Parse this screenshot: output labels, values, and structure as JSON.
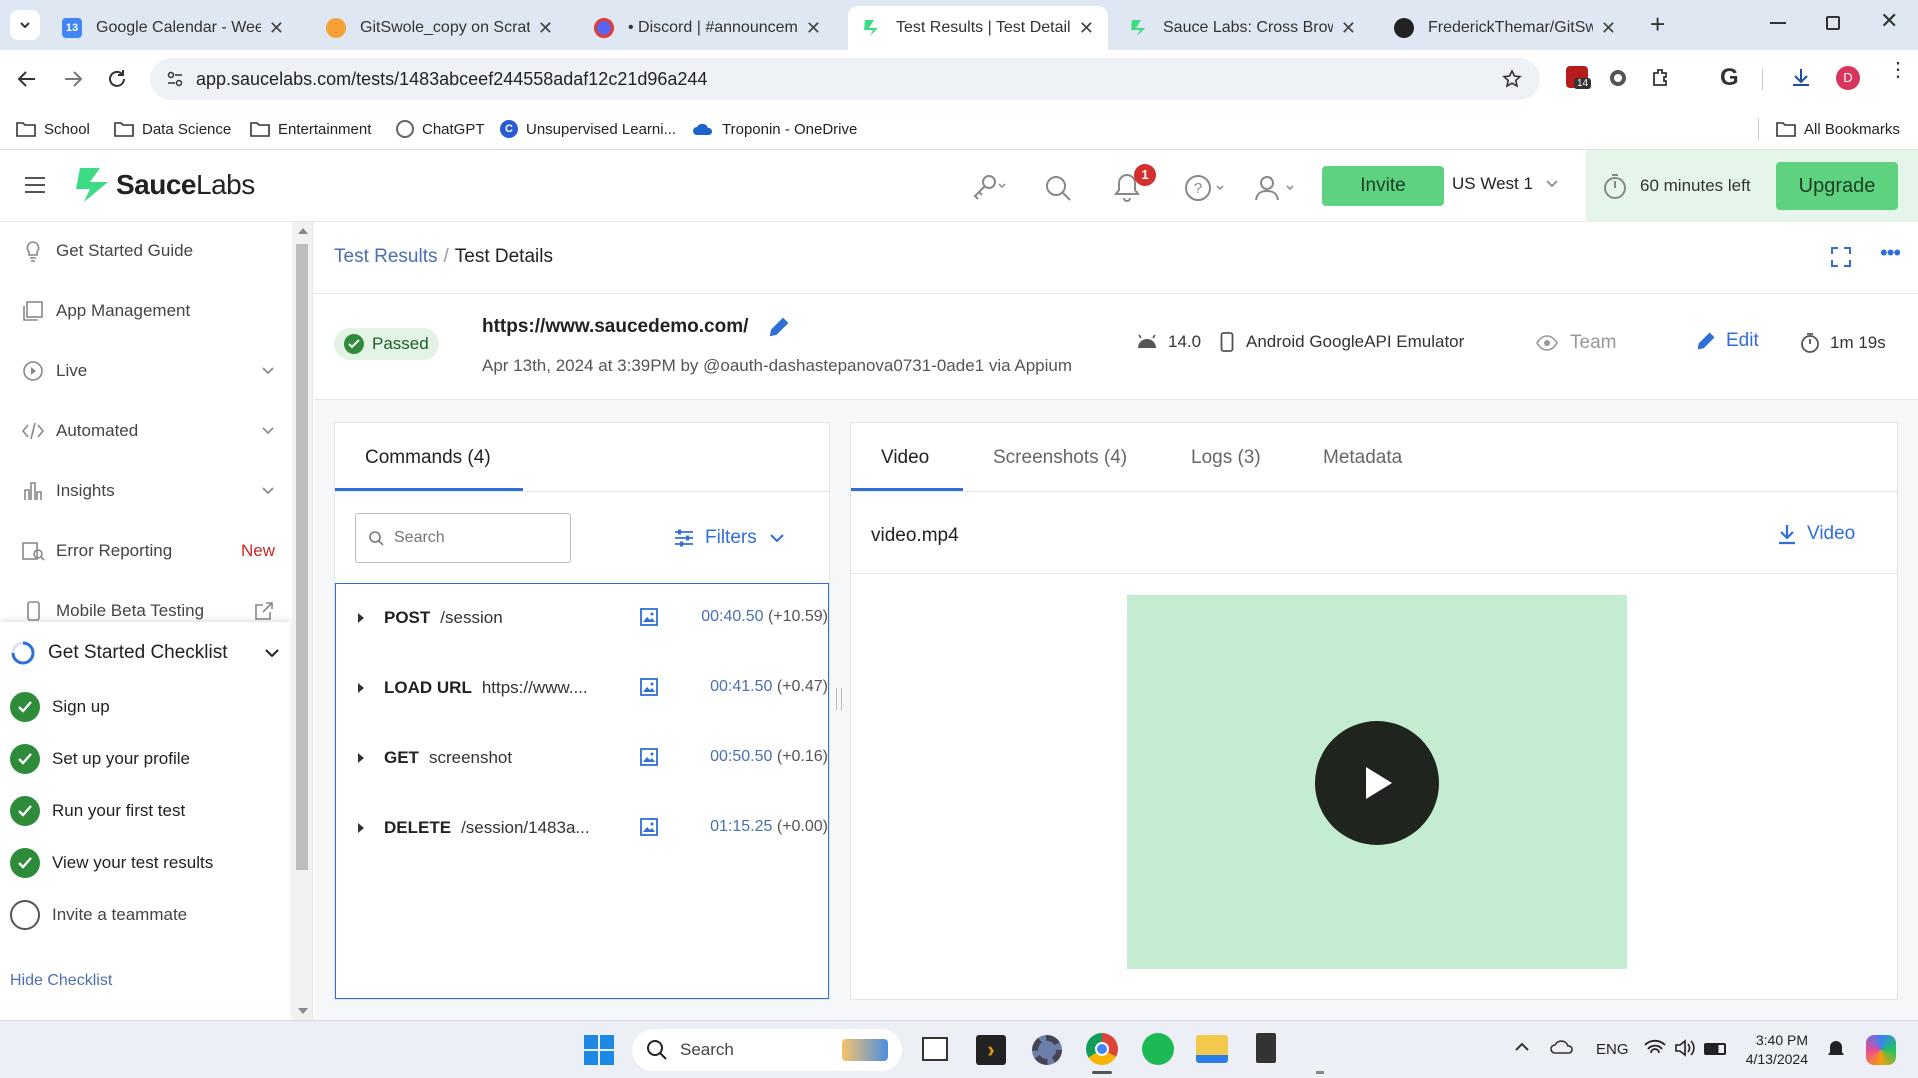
{
  "browser": {
    "tabs": [
      {
        "title": "Google Calendar - Week of",
        "favicon": "google-calendar-icon",
        "color": "#4285f4"
      },
      {
        "title": "GitSwole_copy on Scratch",
        "favicon": "scratch-icon",
        "color": "#f4a236"
      },
      {
        "title": "• Discord | #announcemen",
        "favicon": "discord-icon",
        "color": "#5865f2"
      },
      {
        "title": "Test Results | Test Details | S",
        "favicon": "saucelabs-icon",
        "color": "#3ddc84",
        "active": true
      },
      {
        "title": "Sauce Labs: Cross Browser",
        "favicon": "saucelabs-icon",
        "color": "#3ddc84"
      },
      {
        "title": "FrederickThemar/GitSwole",
        "favicon": "github-icon",
        "color": "#222222"
      }
    ],
    "url": "app.saucelabs.com/tests/1483abceef244558adaf12c21d96a244",
    "extension_badge": "14",
    "profile_initial": "D",
    "bookmarks": [
      "School",
      "Data Science",
      "Entertainment",
      "ChatGPT",
      "Unsupervised Learni...",
      "Troponin - OneDrive"
    ],
    "all_bookmarks": "All Bookmarks"
  },
  "header": {
    "logo_sauce": "Sauce",
    "logo_labs": "Labs",
    "notification_count": "1",
    "invite_label": "Invite",
    "region": "US West 1",
    "trial_text": "60 minutes left",
    "upgrade_label": "Upgrade",
    "accent": "#3ddc84"
  },
  "sidebar": {
    "items": [
      {
        "label": "Get Started Guide",
        "icon": "lightbulb-icon"
      },
      {
        "label": "App Management",
        "icon": "app-management-icon"
      },
      {
        "label": "Live",
        "icon": "play-circle-icon",
        "expandable": true
      },
      {
        "label": "Automated",
        "icon": "code-icon",
        "expandable": true
      },
      {
        "label": "Insights",
        "icon": "bar-chart-icon",
        "expandable": true
      },
      {
        "label": "Error Reporting",
        "icon": "error-report-icon",
        "badge": "New"
      },
      {
        "label": "Mobile Beta Testing",
        "icon": "mobile-icon",
        "external": true
      }
    ],
    "checklist": {
      "title": "Get Started Checklist",
      "items": [
        {
          "label": "Sign up",
          "done": true
        },
        {
          "label": "Set up your profile",
          "done": true
        },
        {
          "label": "Run your first test",
          "done": true
        },
        {
          "label": "View your test results",
          "done": true
        },
        {
          "label": "Invite a teammate",
          "done": false
        }
      ],
      "hide_label": "Hide Checklist"
    }
  },
  "breadcrumb": {
    "parent": "Test Results",
    "separator": "/",
    "current": "Test Details"
  },
  "test": {
    "status": "Passed",
    "url": "https://www.saucedemo.com/",
    "meta": "Apr 13th, 2024 at 3:39PM by @oauth-dashastepanova0731-0ade1 via Appium",
    "os_version": "14.0",
    "device": "Android GoogleAPI Emulator",
    "visibility": "Team",
    "edit_label": "Edit",
    "duration": "1m 19s"
  },
  "commands_panel": {
    "tab_label": "Commands (4)",
    "search_placeholder": "Search",
    "filters_label": "Filters",
    "commands": [
      {
        "method": "POST",
        "path": "/session",
        "time": "00:40.50",
        "delta": "(+10.59)"
      },
      {
        "method": "LOAD URL",
        "path": "https://www....",
        "time": "00:41.50",
        "delta": "(+0.47)"
      },
      {
        "method": "GET",
        "path": "screenshot",
        "time": "00:50.50",
        "delta": "(+0.16)"
      },
      {
        "method": "DELETE",
        "path": "/session/1483a...",
        "time": "01:15.25",
        "delta": "(+0.00)"
      }
    ]
  },
  "media_panel": {
    "tabs": [
      "Video",
      "Screenshots (4)",
      "Logs (3)",
      "Metadata"
    ],
    "active_tab": "Video",
    "filename": "video.mp4",
    "download_label": "Video",
    "video_bg": "#c3ecd0"
  },
  "taskbar": {
    "search_label": "Search",
    "lang": "ENG",
    "time": "3:40 PM",
    "date": "4/13/2024"
  }
}
